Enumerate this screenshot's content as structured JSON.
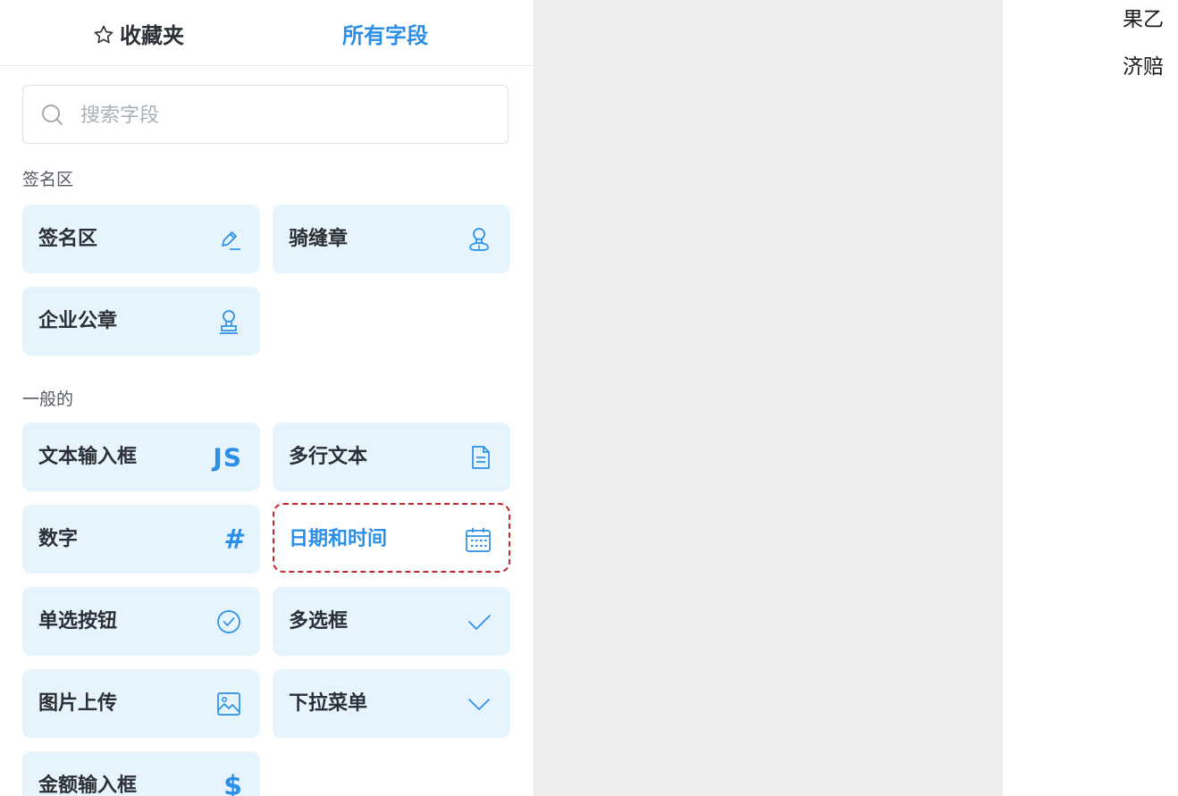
{
  "tabs": {
    "favorites": "收藏夹",
    "all_fields": "所有字段"
  },
  "search": {
    "placeholder": "搜索字段"
  },
  "sections": {
    "signature": {
      "title": "签名区",
      "items": [
        {
          "label": "签名区",
          "icon": "pen-icon"
        },
        {
          "label": "骑缝章",
          "icon": "seal-icon"
        },
        {
          "label": "企业公章",
          "icon": "stamp-icon"
        }
      ]
    },
    "general": {
      "title": "一般的",
      "items": [
        {
          "label": "文本输入框",
          "icon": "js-icon",
          "icon_text": "JS"
        },
        {
          "label": "多行文本",
          "icon": "document-icon"
        },
        {
          "label": "数字",
          "icon": "hash-icon",
          "icon_text": "#"
        },
        {
          "label": "日期和时间",
          "icon": "calendar-icon",
          "selected": true
        },
        {
          "label": "单选按钮",
          "icon": "check-circle-icon"
        },
        {
          "label": "多选框",
          "icon": "checkmark-icon"
        },
        {
          "label": "图片上传",
          "icon": "image-icon"
        },
        {
          "label": "下拉菜单",
          "icon": "chevron-down-icon"
        },
        {
          "label": "金额输入框",
          "icon": "dollar-icon",
          "icon_text": "$"
        }
      ]
    }
  },
  "document": {
    "lines": [
      "果乙",
      "济赔"
    ]
  },
  "colors": {
    "accent": "#2b8fe8",
    "card_bg": "#e6f4fd",
    "highlight": "#c0272d",
    "canvas_bg": "#eeeeee"
  }
}
